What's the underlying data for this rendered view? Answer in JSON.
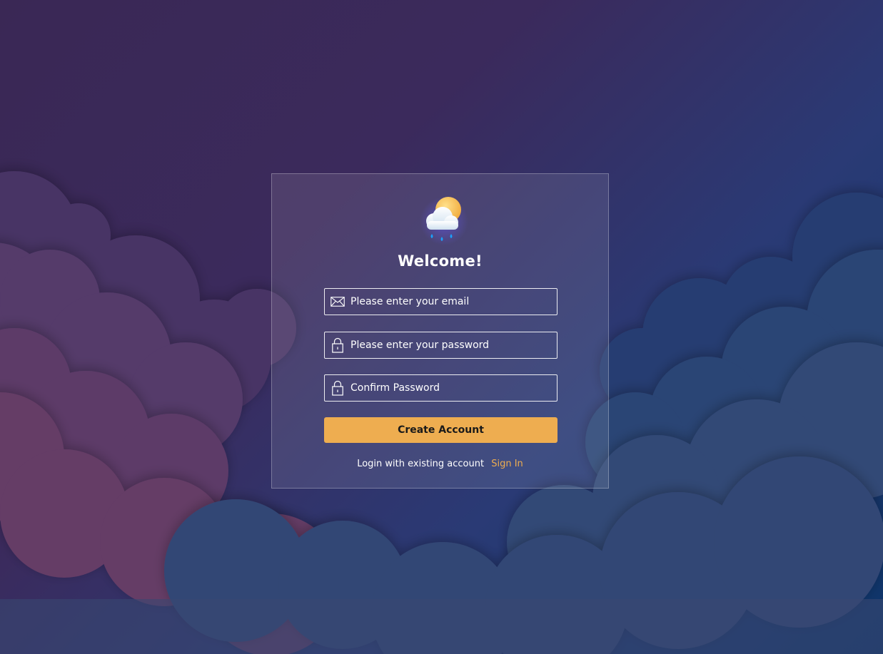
{
  "card": {
    "title": "Welcome!",
    "logo_icon": "cloud-sun-rain-icon"
  },
  "form": {
    "email": {
      "value": "",
      "placeholder": "Please enter your email",
      "icon": "mail-icon"
    },
    "password": {
      "value": "",
      "placeholder": "Please enter your password",
      "icon": "lock-icon"
    },
    "confirm_password": {
      "value": "",
      "placeholder": "Confirm Password",
      "icon": "lock-icon"
    },
    "submit_label": "Create Account"
  },
  "footer": {
    "text": "Login with existing account",
    "link_label": "Sign In"
  },
  "colors": {
    "accent": "#eead50",
    "background_start": "#3a2855",
    "background_end": "#0c3468"
  }
}
